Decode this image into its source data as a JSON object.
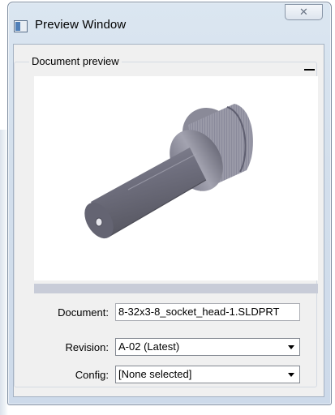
{
  "window": {
    "title": "Preview Window",
    "close_glyph": "✕"
  },
  "group": {
    "title": "Document preview"
  },
  "fields": {
    "document_label": "Document:",
    "document_value": "8-32x3-8_socket_head-1.SLDPRT",
    "revision_label": "Revision:",
    "revision_value": "A-02 (Latest)",
    "config_label": "Config:",
    "config_value": "[None selected]"
  },
  "icons": {
    "app": "window-icon",
    "close": "close-icon",
    "collapse": "collapse-icon",
    "dropdown": "chevron-down-icon"
  }
}
